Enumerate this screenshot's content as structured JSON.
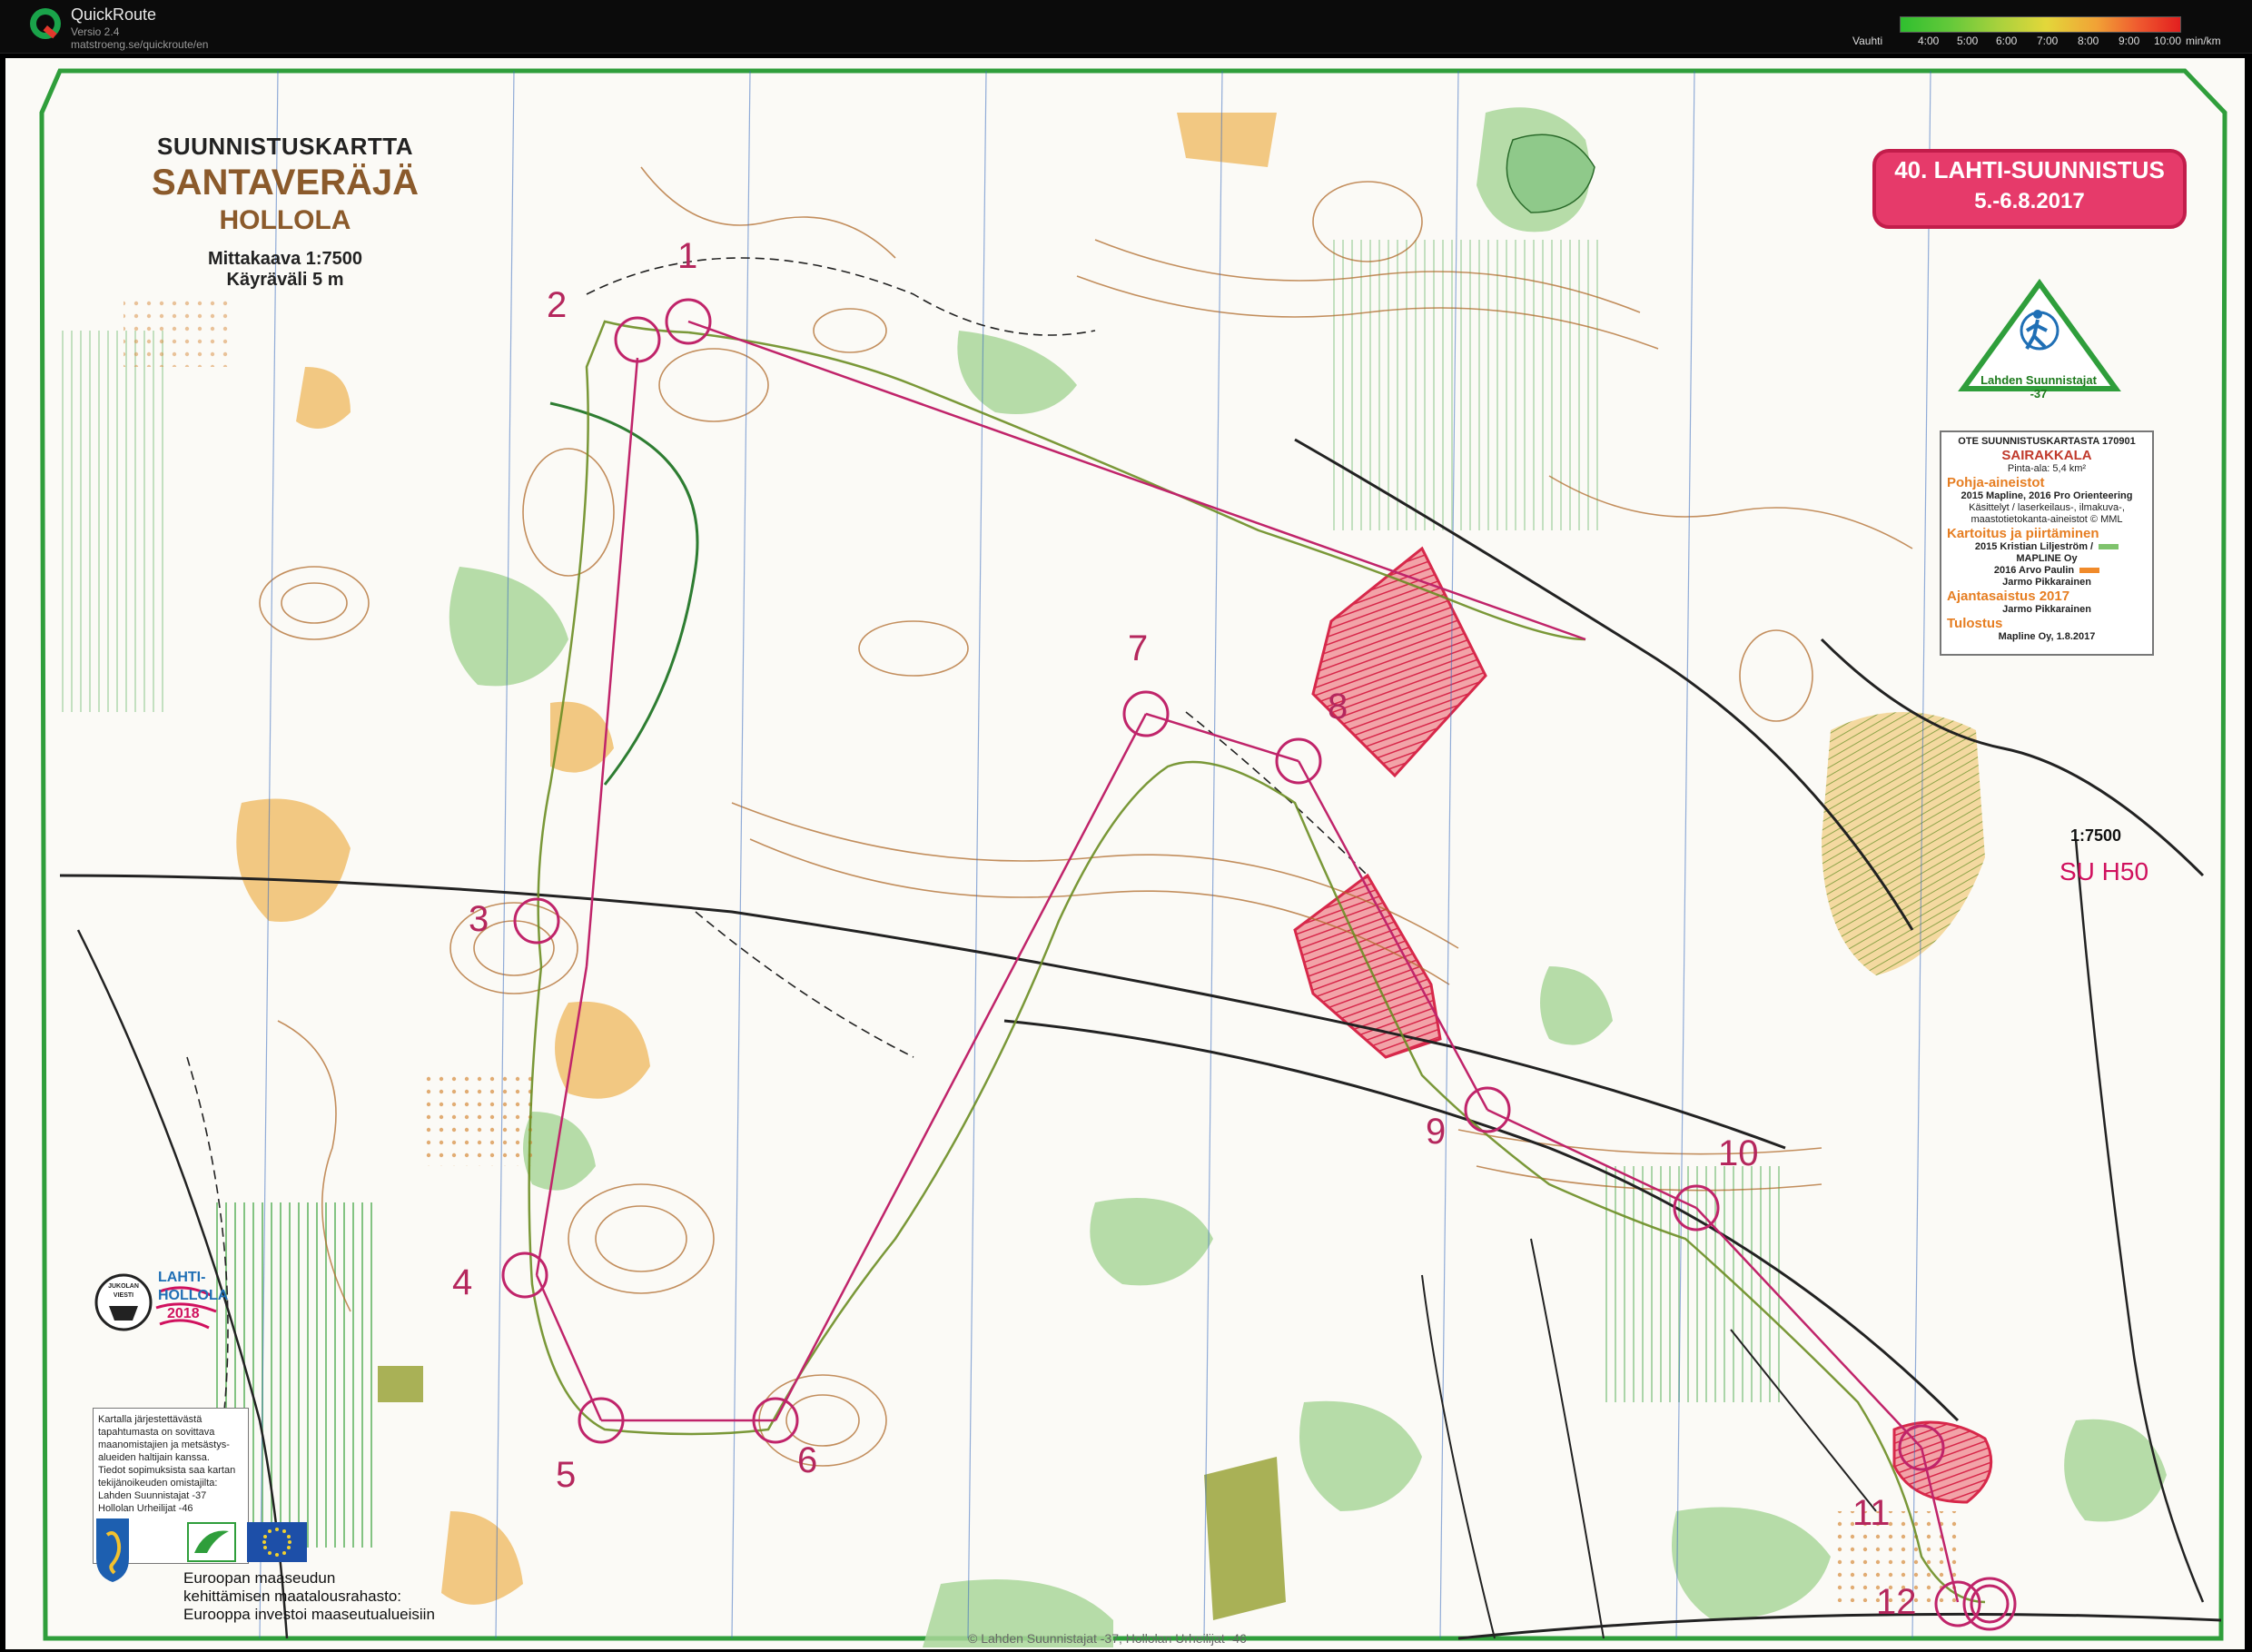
{
  "app": {
    "title": "QuickRoute",
    "version": "Versio 2.4",
    "url": "matstroeng.se/quickroute/en",
    "logo_letter": "Q"
  },
  "pace_legend": {
    "label": "Vauhti",
    "ticks": [
      "4:00",
      "5:00",
      "6:00",
      "7:00",
      "8:00",
      "9:00",
      "10:00"
    ],
    "unit": "min/km"
  },
  "map": {
    "header": "SUUNNISTUSKARTTA",
    "name": "SANTAVERÄJÄ",
    "place": "HOLLOLA",
    "scale": "Mittakaava 1:7500",
    "contour": "Käyräväli 5 m",
    "event_line1": "40. LAHTI-SUUNNISTUS",
    "event_line2": "5.-6.8.2017",
    "club": "Lahden Suunnistajat -37",
    "scale_right": "1:7500",
    "class": "SU H50",
    "copyright": "© Lahden Suunnistajat -37, Hollolan Urheilijat -46"
  },
  "credits": {
    "line1": "OTE SUUNNISTUSKARTASTA 170901",
    "map_name": "SAIRAKKALA",
    "area": "Pinta-ala: 5,4 km²",
    "h1": "Pohja-aineistot",
    "l1": "2015 Mapline, 2016 Pro Orienteering",
    "l2": "Käsittelyt / laserkeilaus-, ilmakuva-,",
    "l3": "maastotietokanta-aineistot © MML",
    "h2": "Kartoitus ja piirtäminen",
    "l4": "2015 Kristian Liljeström /",
    "l5": "MAPLINE Oy",
    "l6": "2016 Arvo Paulin",
    "l7": "Jarmo Pikkarainen",
    "h3": "Ajantasaistus 2017",
    "l8": "Jarmo Pikkarainen",
    "h4": "Tulostus",
    "l9": "Mapline Oy, 1.8.2017"
  },
  "note": [
    "Kartalla järjestettävästä",
    "tapahtumasta on sovittava",
    "maanomistajien ja metsästys-",
    "alueiden haltijain kanssa.",
    "Tiedot sopimuksista saa kartan",
    "tekijänoikeuden omistajilta:",
    "Lahden Suunnistajat -37",
    "Hollolan Urheilijat -46"
  ],
  "funding": {
    "l1": "Euroopan maaseudun",
    "l2": "kehittämisen maatalousrahasto:",
    "l3": "Eurooppa investoi maaseutualueisiin"
  },
  "jukola": {
    "top": "JUKOLAN VIESTI",
    "name1": "LAHTI-",
    "name2": "HOLLOLA",
    "year": "2018"
  },
  "controls": [
    "1",
    "2",
    "3",
    "4",
    "5",
    "6",
    "7",
    "8",
    "9",
    "10",
    "11",
    "12"
  ],
  "colors": {
    "course": "#c0246a",
    "frame": "#2f9e3b",
    "contour": "#b06a2a",
    "vegetation": "#9ccf86",
    "open": "#f3c77a",
    "oob": "#d7284a"
  }
}
